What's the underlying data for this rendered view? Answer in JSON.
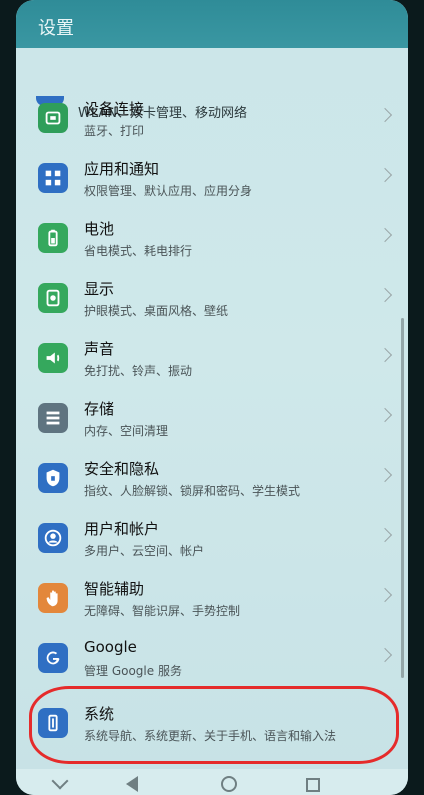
{
  "header": {
    "title": "设置"
  },
  "top_partial": {
    "subtitle": "WLAN、双卡管理、移动网络"
  },
  "items": [
    {
      "label": "设备连接",
      "subtitle": "蓝牙、打印",
      "icon": "device-connection-icon",
      "color": "#2f9e5a"
    },
    {
      "label": "应用和通知",
      "subtitle": "权限管理、默认应用、应用分身",
      "icon": "apps-grid-icon",
      "color": "#2f6fc3"
    },
    {
      "label": "电池",
      "subtitle": "省电模式、耗电排行",
      "icon": "battery-icon",
      "color": "#35a85d"
    },
    {
      "label": "显示",
      "subtitle": "护眼模式、桌面风格、壁纸",
      "icon": "display-icon",
      "color": "#35a85d"
    },
    {
      "label": "声音",
      "subtitle": "免打扰、铃声、振动",
      "icon": "sound-icon",
      "color": "#35a85d"
    },
    {
      "label": "存储",
      "subtitle": "内存、空间清理",
      "icon": "storage-icon",
      "color": "#5f7480"
    },
    {
      "label": "安全和隐私",
      "subtitle": "指纹、人脸解锁、锁屏和密码、学生模式",
      "icon": "shield-icon",
      "color": "#2f6fc3"
    },
    {
      "label": "用户和帐户",
      "subtitle": "多用户、云空间、帐户",
      "icon": "user-account-icon",
      "color": "#2f6fc3"
    },
    {
      "label": "智能辅助",
      "subtitle": "无障碍、智能识屏、手势控制",
      "icon": "hand-icon",
      "color": "#e3873b"
    },
    {
      "label": "Google",
      "subtitle": "管理 Google 服务",
      "icon": "google-icon",
      "color": "#2f6fc3"
    },
    {
      "label": "系统",
      "subtitle": "系统导航、系统更新、关于手机、语言和输入法",
      "icon": "system-phone-icon",
      "color": "#2f6fc3"
    }
  ],
  "annotation": {
    "color": "#e52b2b"
  }
}
